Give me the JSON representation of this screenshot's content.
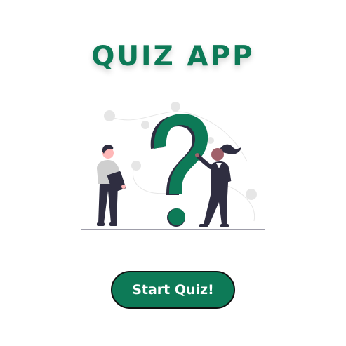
{
  "app": {
    "title": "QUIZ APP"
  },
  "hero": {
    "illustration": "people-with-question-mark-illustration"
  },
  "actions": {
    "start_label": "Start Quiz!"
  },
  "colors": {
    "accent": "#0d7a57",
    "button_text": "#ffffff",
    "button_border": "#111111",
    "figure_dark": "#2f2e41",
    "figure_light": "#e6e6e6"
  }
}
